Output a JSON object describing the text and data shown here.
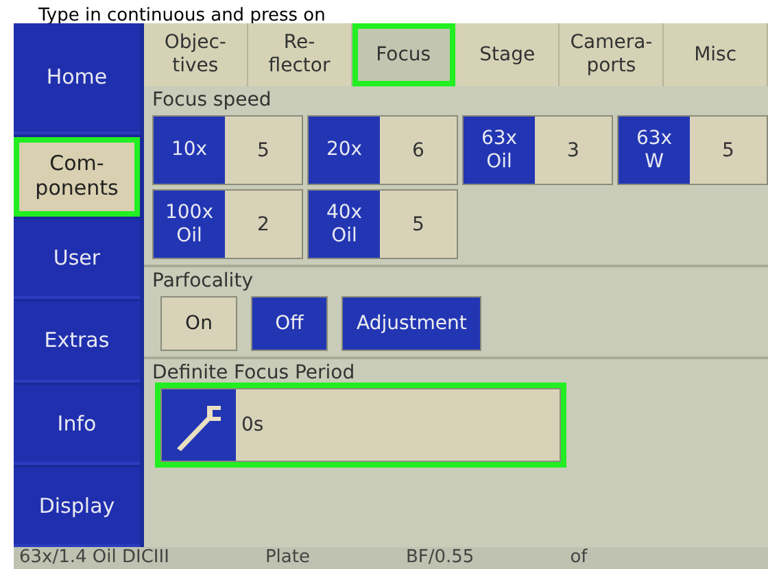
{
  "caption": "Type in continuous and press on",
  "sidebar": {
    "items": [
      {
        "label": "Home",
        "selected": false,
        "highlighted": false
      },
      {
        "label": "Com-\nponents",
        "selected": true,
        "highlighted": true
      },
      {
        "label": "User",
        "selected": false,
        "highlighted": false
      },
      {
        "label": "Extras",
        "selected": false,
        "highlighted": false
      },
      {
        "label": "Info",
        "selected": false,
        "highlighted": false
      },
      {
        "label": "Display",
        "selected": false,
        "highlighted": false
      }
    ]
  },
  "tabs": [
    {
      "label": "Objec-\ntives",
      "selected": false,
      "highlighted": false
    },
    {
      "label": "Re-\nflector",
      "selected": false,
      "highlighted": false
    },
    {
      "label": "Focus",
      "selected": true,
      "highlighted": true
    },
    {
      "label": "Stage",
      "selected": false,
      "highlighted": false
    },
    {
      "label": "Camera-\nports",
      "selected": false,
      "highlighted": false
    },
    {
      "label": "Misc",
      "selected": false,
      "highlighted": false
    }
  ],
  "focus_speed": {
    "label": "Focus speed",
    "rows": [
      [
        {
          "objective": "10x",
          "speed": "5"
        },
        {
          "objective": "20x",
          "speed": "6"
        },
        {
          "objective": "63x\nOil",
          "speed": "3"
        },
        {
          "objective": "63x\nW",
          "speed": "5"
        }
      ],
      [
        {
          "objective": "100x\nOil",
          "speed": "2"
        },
        {
          "objective": "40x\nOil",
          "speed": "5"
        }
      ]
    ]
  },
  "parfocality": {
    "label": "Parfocality",
    "buttons": [
      {
        "label": "On",
        "selected": true
      },
      {
        "label": "Off",
        "selected": false
      },
      {
        "label": "Adjustment",
        "selected": false
      }
    ]
  },
  "definite_focus_period": {
    "label": "Definite Focus Period",
    "value": "0s",
    "highlighted": true
  },
  "status_bar": [
    "63x/1.4 Oil DICIII",
    "Plate",
    "BF/0.55",
    "of"
  ]
}
